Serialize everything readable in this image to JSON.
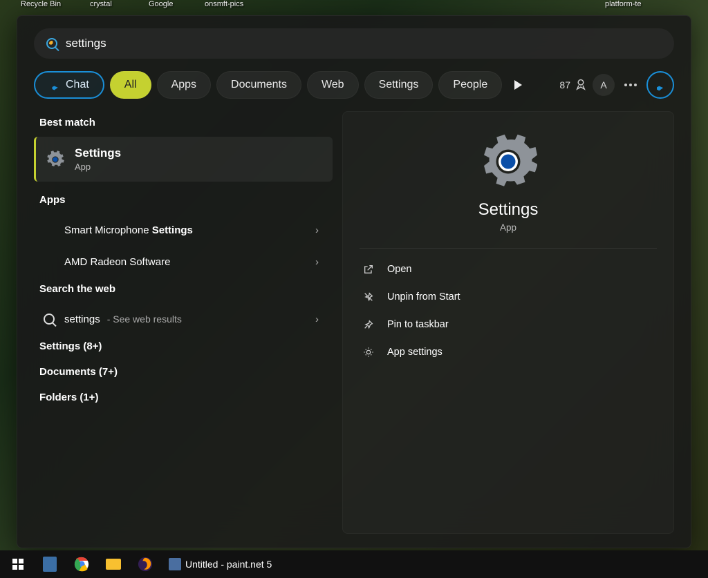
{
  "desktop_icons": {
    "recycle": "Recycle Bin",
    "crystal": "crystal",
    "google": "Google",
    "onmsft": "onsmft-pics",
    "platform": "platform-te"
  },
  "search": {
    "query": "settings"
  },
  "filters": {
    "chat": "Chat",
    "all": "All",
    "apps": "Apps",
    "documents": "Documents",
    "web": "Web",
    "settings": "Settings",
    "people": "People"
  },
  "rewards": {
    "points": "87"
  },
  "avatar_letter": "A",
  "left": {
    "best_match_label": "Best match",
    "best": {
      "title": "Settings",
      "subtitle": "App"
    },
    "apps_label": "Apps",
    "apps": [
      {
        "prefix": "Smart Microphone ",
        "bold": "Settings"
      },
      {
        "prefix": "AMD Radeon Software",
        "bold": ""
      }
    ],
    "web_label": "Search the web",
    "web": {
      "query": "settings",
      "suffix": " - See web results"
    },
    "settings_group": "Settings (8+)",
    "documents_group": "Documents (7+)",
    "folders_group": "Folders (1+)"
  },
  "right": {
    "title": "Settings",
    "subtitle": "App",
    "actions": {
      "open": "Open",
      "unpin": "Unpin from Start",
      "pin_taskbar": "Pin to taskbar",
      "app_settings": "App settings"
    }
  },
  "taskbar": {
    "title": "Untitled - paint.net 5"
  }
}
